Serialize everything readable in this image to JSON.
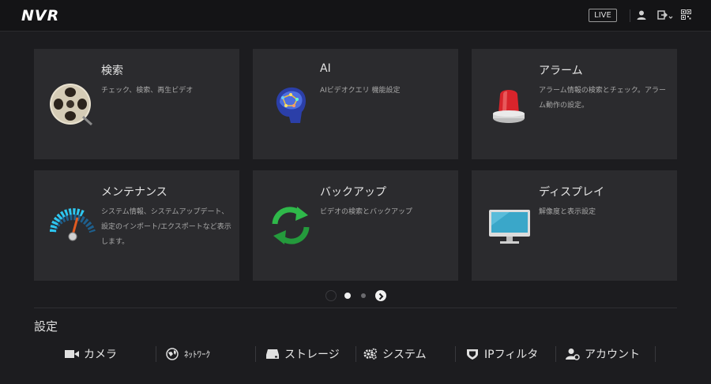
{
  "header": {
    "logo": "NVR",
    "live_label": "LIVE",
    "icons": [
      "user-icon",
      "logout-icon",
      "qr-code-icon"
    ]
  },
  "cards": [
    {
      "title": "検索",
      "desc": "チェック、検索、再生ビデオ",
      "icon": "film-reel-search-icon"
    },
    {
      "title": "AI",
      "desc": "AIビデオクエリ 機能設定",
      "icon": "ai-brain-icon"
    },
    {
      "title": "アラーム",
      "desc": "アラーム情報の検索とチェック。アラーム動作の設定。",
      "icon": "alarm-siren-icon"
    },
    {
      "title": "メンテナンス",
      "desc": "システム情報、システムアップデート、設定のインポート/エクスポートなど表示します。",
      "icon": "gauge-icon"
    },
    {
      "title": "バックアップ",
      "desc": "ビデオの検索とバックアップ",
      "icon": "sync-arrows-icon"
    },
    {
      "title": "ディスプレイ",
      "desc": "解像度と表示設定",
      "icon": "monitor-icon"
    }
  ],
  "pager": {
    "pages": 2,
    "current": 1
  },
  "settings": {
    "title": "設定",
    "items": [
      {
        "label": "カメラ",
        "icon": "camera-icon"
      },
      {
        "label": "ﾈｯﾄﾜｰｸ",
        "icon": "network-globe-icon"
      },
      {
        "label": "ストレージ",
        "icon": "hard-drive-icon"
      },
      {
        "label": "システム",
        "icon": "gears-icon"
      },
      {
        "label": "IPフィルタ",
        "icon": "shield-icon"
      },
      {
        "label": "アカウント",
        "icon": "user-settings-icon"
      }
    ]
  },
  "colors": {
    "background": "#1c1c1f",
    "topbar": "#141416",
    "card": "#2b2b2e",
    "siren_red": "#d8242b",
    "sync_green": "#2fb84a",
    "gauge_cyan": "#2ec7f0"
  }
}
